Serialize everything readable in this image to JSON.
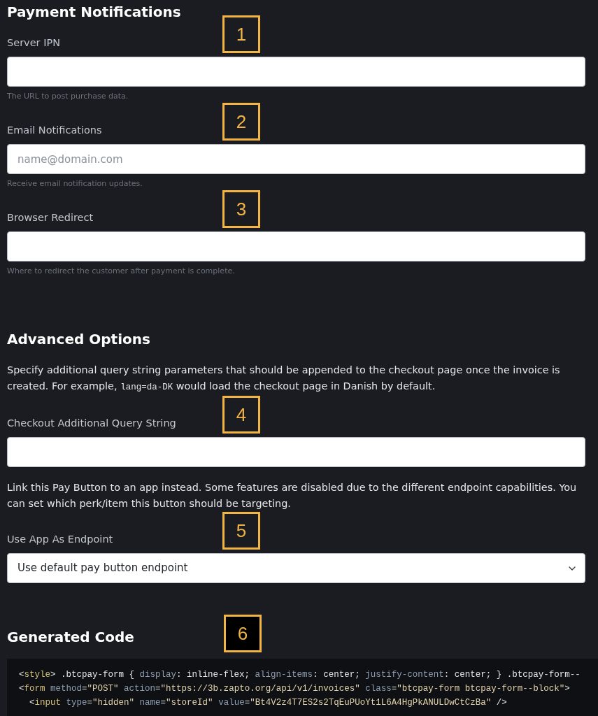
{
  "payment_notifications": {
    "title": "Payment Notifications",
    "fields": [
      {
        "kind": "input",
        "label": "Server IPN",
        "marker": {
          "label": "1",
          "filled": false
        },
        "help": "The URL to post purchase data."
      },
      {
        "kind": "input",
        "label": "Email Notifications",
        "placeholder": "name@domain.com",
        "marker": {
          "label": "2",
          "filled": false
        },
        "help": "Receive email notification updates."
      },
      {
        "kind": "input",
        "label": "Browser Redirect",
        "marker": {
          "label": "3",
          "filled": false
        },
        "help": "Where to redirect the customer after payment is complete."
      }
    ]
  },
  "advanced_options": {
    "title": "Advanced Options",
    "blocks": [
      {
        "kind": "paragraph",
        "parts": [
          {
            "kind": "text",
            "text": "Specify additional query string parameters that should be appended to the checkout page once the invoice is created. For example, "
          },
          {
            "kind": "code",
            "text": "lang=da-DK"
          },
          {
            "kind": "text",
            "text": " would load the checkout page in Danish by default."
          }
        ]
      },
      {
        "kind": "input",
        "label": "Checkout Additional Query String",
        "marker": {
          "label": "4",
          "filled": false
        }
      },
      {
        "kind": "paragraph",
        "parts": [
          {
            "kind": "text",
            "text": "Link this Pay Button to an app instead. Some features are disabled due to the different endpoint capabilities. You can set which perk/item this button should be targeting."
          }
        ]
      },
      {
        "kind": "select",
        "label": "Use App As Endpoint",
        "value": "Use default pay button endpoint",
        "marker": {
          "label": "5",
          "filled": false
        }
      }
    ]
  },
  "generated_code": {
    "title": "Generated Code",
    "marker": {
      "label": "6",
      "filled": true
    },
    "lines": [
      {
        "tokens": [
          {
            "kind": "plain",
            "text": "<"
          },
          {
            "kind": "tag",
            "text": "style"
          },
          {
            "kind": "plain",
            "text": "> .btcpay-form { "
          },
          {
            "kind": "attr",
            "text": "display"
          },
          {
            "kind": "plain",
            "text": ": inline-flex; "
          },
          {
            "kind": "attr",
            "text": "align-items"
          },
          {
            "kind": "plain",
            "text": ": center; "
          },
          {
            "kind": "attr",
            "text": "justify-content"
          },
          {
            "kind": "plain",
            "text": ": center; } .btcpay-form--"
          }
        ]
      },
      {
        "tokens": [
          {
            "kind": "plain",
            "text": "<"
          },
          {
            "kind": "tag",
            "text": "form"
          },
          {
            "kind": "attr",
            "text": " method"
          },
          {
            "kind": "plain",
            "text": "="
          },
          {
            "kind": "string",
            "text": "\"POST\""
          },
          {
            "kind": "attr",
            "text": " action"
          },
          {
            "kind": "plain",
            "text": "="
          },
          {
            "kind": "string",
            "text": "\"https://3b.zapto.org/api/v1/invoices\""
          },
          {
            "kind": "attr",
            "text": " class"
          },
          {
            "kind": "plain",
            "text": "="
          },
          {
            "kind": "string",
            "text": "\"btcpay-form btcpay-form--block\""
          },
          {
            "kind": "plain",
            "text": ">"
          }
        ]
      },
      {
        "tokens": [
          {
            "kind": "plain",
            "text": "  <"
          },
          {
            "kind": "tag",
            "text": "input"
          },
          {
            "kind": "attr",
            "text": " type"
          },
          {
            "kind": "plain",
            "text": "="
          },
          {
            "kind": "string",
            "text": "\"hidden\""
          },
          {
            "kind": "attr",
            "text": " name"
          },
          {
            "kind": "plain",
            "text": "="
          },
          {
            "kind": "string",
            "text": "\"storeId\""
          },
          {
            "kind": "attr",
            "text": " value"
          },
          {
            "kind": "plain",
            "text": "="
          },
          {
            "kind": "string",
            "text": "\"Bt4V2z4T7ES2s2TqEuPUoYt1L6A4HgPkANULDwCtCzBa\""
          },
          {
            "kind": "plain",
            "text": " />"
          }
        ]
      }
    ]
  }
}
